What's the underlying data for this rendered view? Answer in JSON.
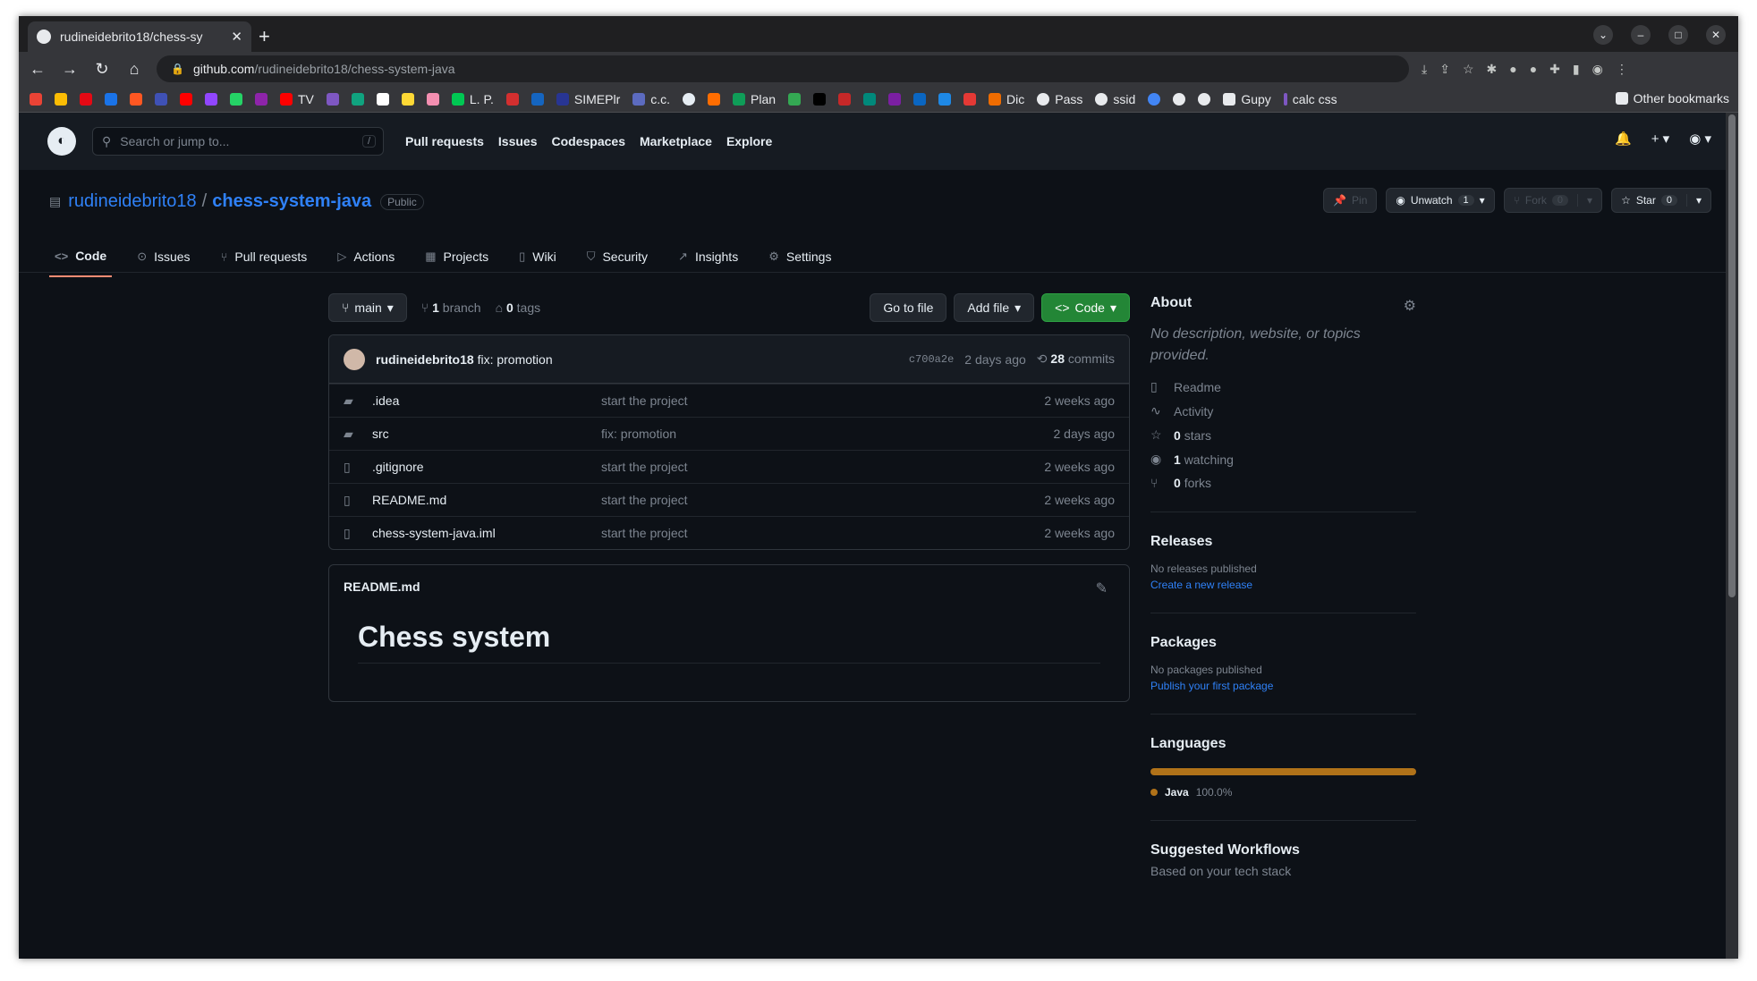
{
  "browser": {
    "tab_title": "rudineidebrito18/chess-sy",
    "url_host": "github.com",
    "url_path": "/rudineidebrito18/chess-system-java",
    "bookmarks": [
      "TV",
      "L. P.",
      "SIMEPlr",
      "c.c.",
      "Plan",
      "Dic",
      "Pass",
      "ssid",
      "Gupy",
      "calc css"
    ],
    "other_bookmarks": "Other bookmarks"
  },
  "gh": {
    "search_placeholder": "Search or jump to...",
    "search_key": "/",
    "nav": [
      "Pull requests",
      "Issues",
      "Codespaces",
      "Marketplace",
      "Explore"
    ]
  },
  "repo": {
    "owner": "rudineidebrito18",
    "name": "chess-system-java",
    "visibility": "Public",
    "pin": "Pin",
    "unwatch": "Unwatch",
    "watch_count": "1",
    "fork": "Fork",
    "fork_count": "0",
    "star": "Star",
    "star_count": "0",
    "tabs": [
      "Code",
      "Issues",
      "Pull requests",
      "Actions",
      "Projects",
      "Wiki",
      "Security",
      "Insights",
      "Settings"
    ]
  },
  "filebar": {
    "branch": "main",
    "branch_count": "1",
    "branch_label": "branch",
    "tag_count": "0",
    "tag_label": "tags",
    "go_to_file": "Go to file",
    "add_file": "Add file",
    "code": "Code"
  },
  "commit": {
    "author": "rudineidebrito18",
    "message": "fix: promotion",
    "sha": "c700a2e",
    "age": "2 days ago",
    "count": "28",
    "count_label": "commits"
  },
  "files": [
    {
      "name": ".idea",
      "type": "dir",
      "message": "start the project",
      "age": "2 weeks ago"
    },
    {
      "name": "src",
      "type": "dir",
      "message": "fix: promotion",
      "age": "2 days ago"
    },
    {
      "name": ".gitignore",
      "type": "file",
      "message": "start the project",
      "age": "2 weeks ago"
    },
    {
      "name": "README.md",
      "type": "file",
      "message": "start the project",
      "age": "2 weeks ago"
    },
    {
      "name": "chess-system-java.iml",
      "type": "file",
      "message": "start the project",
      "age": "2 weeks ago"
    }
  ],
  "readme": {
    "filename": "README.md",
    "heading": "Chess system"
  },
  "about": {
    "title": "About",
    "description": "No description, website, or topics provided.",
    "readme": "Readme",
    "activity": "Activity",
    "stars_n": "0",
    "stars": "stars",
    "watching_n": "1",
    "watching": "watching",
    "forks_n": "0",
    "forks": "forks"
  },
  "releases": {
    "title": "Releases",
    "none": "No releases published",
    "link": "Create a new release"
  },
  "packages": {
    "title": "Packages",
    "none": "No packages published",
    "link": "Publish your first package"
  },
  "languages": {
    "title": "Languages",
    "name": "Java",
    "percent": "100.0%",
    "share": 1.0,
    "color": "#b07219"
  },
  "workflows": {
    "title": "Suggested Workflows",
    "subtitle": "Based on your tech stack"
  }
}
